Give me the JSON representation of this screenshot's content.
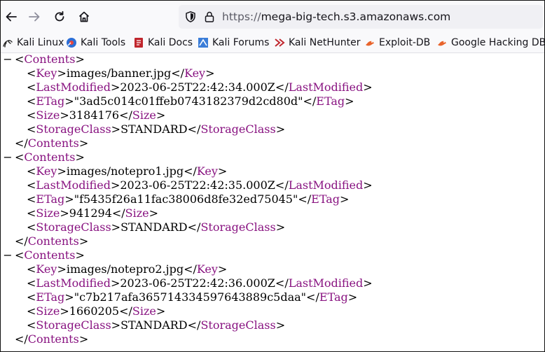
{
  "browser": {
    "url_scheme": "https://",
    "url_host": "mega-big-tech.s3.amazonaws.com",
    "nav": {
      "back_icon": "arrow-left-icon",
      "forward_icon": "arrow-right-icon",
      "reload_icon": "reload-icon",
      "home_icon": "home-icon",
      "shield_icon": "shield-icon",
      "lock_icon": "lock-icon"
    }
  },
  "bookmarks": [
    {
      "label": "Kali Linux",
      "icon": "kali-dragon-icon"
    },
    {
      "label": "Kali Tools",
      "icon": "kali-tools-icon"
    },
    {
      "label": "Kali Docs",
      "icon": "kali-docs-icon"
    },
    {
      "label": "Kali Forums",
      "icon": "kali-forums-icon"
    },
    {
      "label": "Kali NetHunter",
      "icon": "kali-nethunter-icon"
    },
    {
      "label": "Exploit-DB",
      "icon": "exploit-db-icon"
    },
    {
      "label": "Google Hacking DB",
      "icon": "ghdb-icon"
    }
  ],
  "xml": {
    "fold_symbol": "−",
    "contents_tag": "Contents",
    "field_tags": {
      "key": "Key",
      "last_modified": "LastModified",
      "etag": "ETag",
      "size": "Size",
      "storage_class": "StorageClass"
    },
    "objects": [
      {
        "key": "images/banner.jpg",
        "last_modified": "2023-06-25T22:42:34.000Z",
        "etag": "\"3ad5c014c01ffeb0743182379d2cd80d\"",
        "size": "3184176",
        "storage_class": "STANDARD"
      },
      {
        "key": "images/notepro1.jpg",
        "last_modified": "2023-06-25T22:42:35.000Z",
        "etag": "\"f5435f26a11fac38006d8fe32ed75045\"",
        "size": "941294",
        "storage_class": "STANDARD"
      },
      {
        "key": "images/notepro2.jpg",
        "last_modified": "2023-06-25T22:42:36.000Z",
        "etag": "\"c7b217afa365714334597643889c5daa\"",
        "size": "1660205",
        "storage_class": "STANDARD"
      }
    ]
  },
  "colors": {
    "tag": "#881280",
    "toolbar_bg": "#f9f9fb",
    "urlbar_bg": "#f0f0f4"
  }
}
